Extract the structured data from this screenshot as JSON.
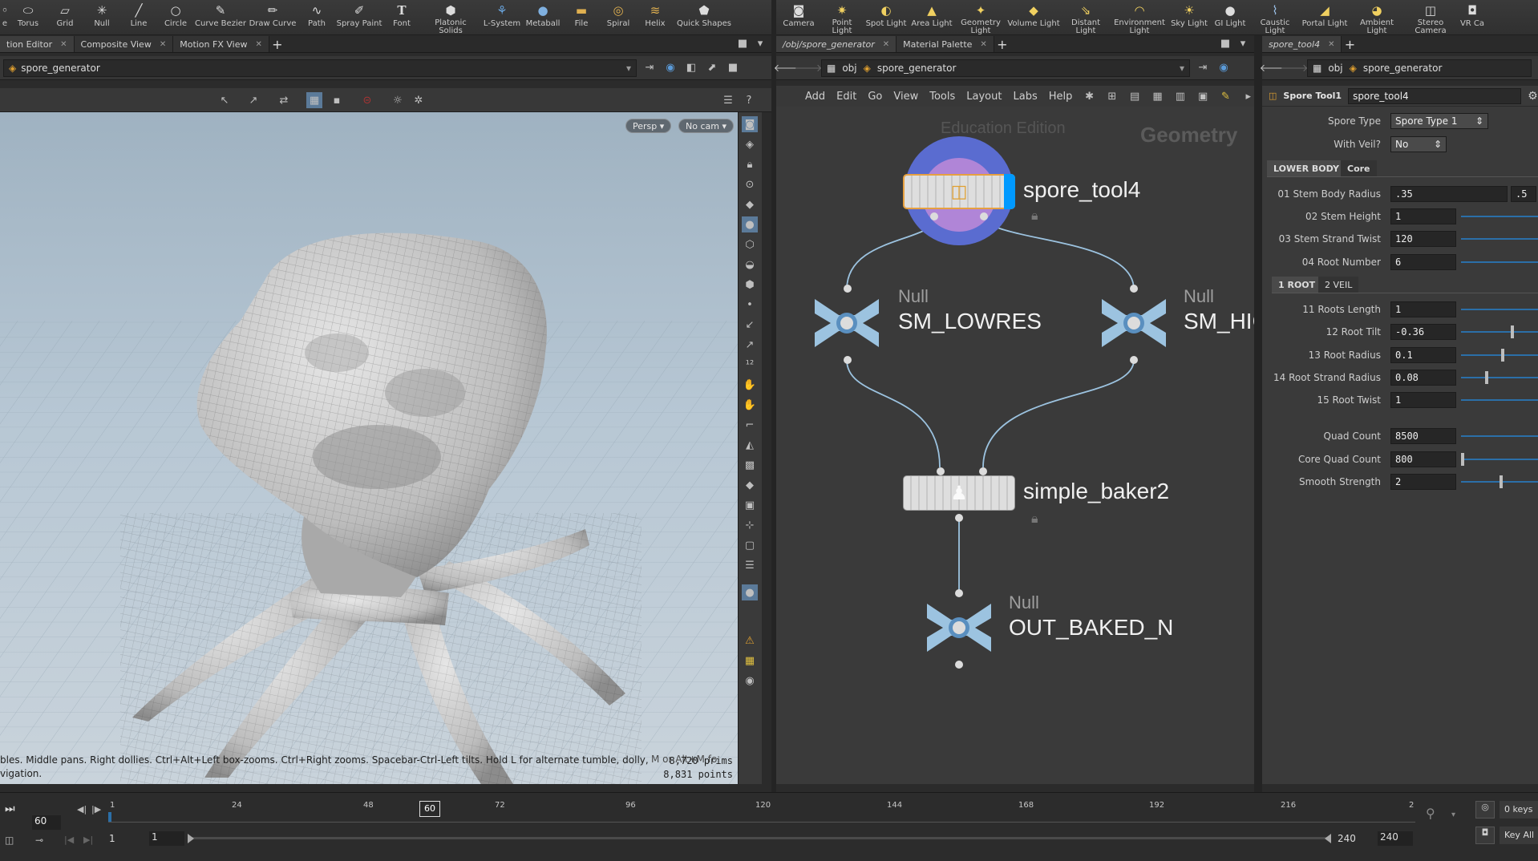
{
  "left_shelf": {
    "tools": [
      "e",
      "Torus",
      "Grid",
      "Null",
      "Line",
      "Circle",
      "Curve Bezier",
      "Draw Curve",
      "Path",
      "Spray Paint",
      "Font",
      "Platonic Solids",
      "L-System",
      "Metaball",
      "File",
      "Spiral",
      "Helix",
      "Quick Shapes"
    ]
  },
  "right_shelf": {
    "tools": [
      "Camera",
      "Point Light",
      "Spot Light",
      "Area Light",
      "Geometry Light",
      "Volume Light",
      "Distant Light",
      "Environment Light",
      "Sky Light",
      "GI Light",
      "Caustic Light",
      "Portal Light",
      "Ambient Light",
      "Stereo Camera",
      "VR Ca"
    ]
  },
  "left_tabs": [
    "tion Editor",
    "Composite View",
    "Motion FX View"
  ],
  "mid_tabs": [
    "/obj/spore_generator",
    "Material Palette"
  ],
  "right_tabs": [
    "spore_tool4"
  ],
  "viewport": {
    "path": "spore_generator",
    "persp": "Persp ▾",
    "cam": "No cam ▾",
    "help_line1": "bles. Middle pans. Right dollies. Ctrl+Alt+Left box-zooms. Ctrl+Right zooms. Spacebar-Ctrl-Left tilts. Hold L for alternate tumble, dolly, and zoom.",
    "help_line2": "vigation.",
    "help_extra": "M or Alt+M fo",
    "prims": "8,720  prims",
    "points": "8,831  points"
  },
  "network": {
    "path_root": "obj",
    "path_node": "spore_generator",
    "menu": [
      "Add",
      "Edit",
      "Go",
      "View",
      "Tools",
      "Layout",
      "Labs",
      "Help"
    ],
    "watermark": "Education Edition",
    "context": "Geometry",
    "nodes": {
      "spore_tool": "spore_tool4",
      "null_low_type": "Null",
      "null_low": "SM_LOWRES",
      "null_high_type": "Null",
      "null_high": "SM_HIG",
      "baker": "simple_baker2",
      "out_type": "Null",
      "out": "OUT_BAKED_N"
    }
  },
  "params": {
    "path_root": "obj",
    "path_node": "spore_generator",
    "node_type": "Spore Tool1",
    "node_name": "spore_tool4",
    "spore_type_label": "Spore Type",
    "spore_type_value": "Spore Type 1",
    "veil_label": "With Veil?",
    "veil_value": "No",
    "tabs_main": [
      "LOWER BODY",
      "Core"
    ],
    "rows_a": [
      {
        "label": "01 Stem Body Radius",
        "value": ".35",
        "value2": ".5"
      },
      {
        "label": "02 Stem Height",
        "value": "1"
      },
      {
        "label": "03 Stem Strand Twist",
        "value": "120"
      },
      {
        "label": "04 Root Number",
        "value": "6"
      }
    ],
    "tabs_sub": [
      "1 ROOT",
      "2 VEIL"
    ],
    "rows_b": [
      {
        "label": "11 Roots Length",
        "value": "1"
      },
      {
        "label": "12 Root Tilt",
        "value": "-0.36"
      },
      {
        "label": "13 Root Radius",
        "value": "0.1"
      },
      {
        "label": "14 Root Strand Radius",
        "value": "0.08"
      },
      {
        "label": "15 Root Twist",
        "value": "1"
      }
    ],
    "rows_c": [
      {
        "label": "Quad Count",
        "value": "8500"
      },
      {
        "label": "Core Quad Count",
        "value": "800"
      },
      {
        "label": "Smooth Strength",
        "value": "2"
      }
    ]
  },
  "timeline": {
    "frame": "60",
    "current_marker": "60",
    "ticks": [
      "1",
      "24",
      "48",
      "72",
      "96",
      "120",
      "144",
      "168",
      "192",
      "216",
      "2"
    ],
    "range_start": "1",
    "range_start2": "1",
    "range_end": "240",
    "range_end2": "240",
    "keys": "0 keys",
    "key_all": "Key All"
  },
  "colors": {
    "accent": "#2b6fa8",
    "node_blue": "#9cc3e0",
    "spore_ring_outer": "#5a6cd0",
    "spore_ring_inner": "#c08ad8",
    "selected_bar": "#0099ff"
  }
}
